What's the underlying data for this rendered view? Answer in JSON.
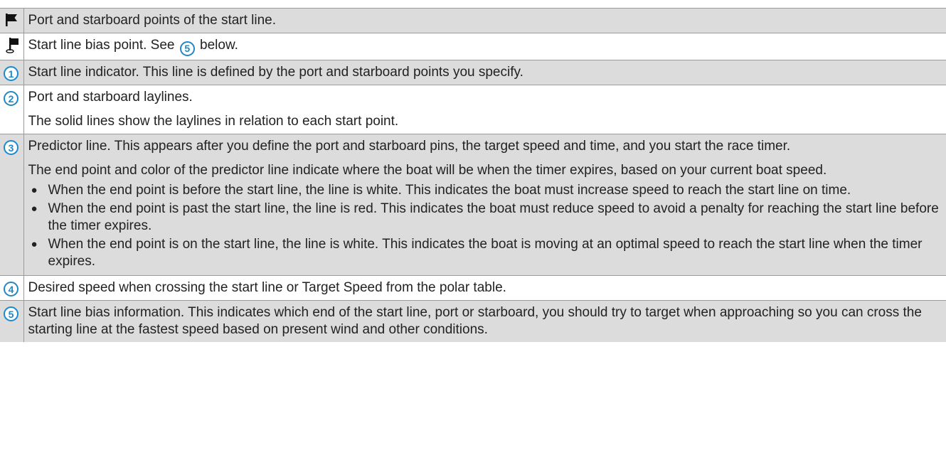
{
  "rows": [
    {
      "icon": "flag-icon",
      "text": "Port and starboard points of the start line."
    },
    {
      "icon": "bias-flag-icon",
      "text_before": "Start line bias point. See",
      "ref_badge": "5",
      "text_after": "below."
    },
    {
      "icon": "badge",
      "badge": "1",
      "text": "Start line indicator. This line is defined by the port and starboard points you specify."
    },
    {
      "icon": "badge",
      "badge": "2",
      "para1": "Port and starboard laylines.",
      "para2": "The solid lines show the laylines in relation to each start point."
    },
    {
      "icon": "badge",
      "badge": "3",
      "para1": "Predictor line. This appears after you define the port and starboard pins, the target speed and time, and you start the race timer.",
      "para2": "The end point and color of the predictor line indicate where the boat will be when the timer expires, based on your current boat speed.",
      "bullets": [
        "When the end point is before the start line, the line is white. This indicates the boat must increase speed to reach the start line on time.",
        "When the end point is past the start line, the line is red. This indicates the boat must reduce speed to avoid a penalty for reaching the start line before the timer expires.",
        "When the end point is on the start line, the line is white. This indicates the boat is moving at an optimal speed to reach the start line when the timer expires."
      ]
    },
    {
      "icon": "badge",
      "badge": "4",
      "text": "Desired speed when crossing the start line or Target Speed from the polar table."
    },
    {
      "icon": "badge",
      "badge": "5",
      "text": "Start line bias information. This indicates which end of the start line, port or starboard, you should try to target when approaching so you can cross the starting line at the fastest speed based on present wind and other conditions."
    }
  ],
  "bullet_glyph": "●",
  "colors": {
    "badge": "#1e88c8",
    "shaded_row": "#dcdcdc",
    "border": "#9a9a9a"
  }
}
